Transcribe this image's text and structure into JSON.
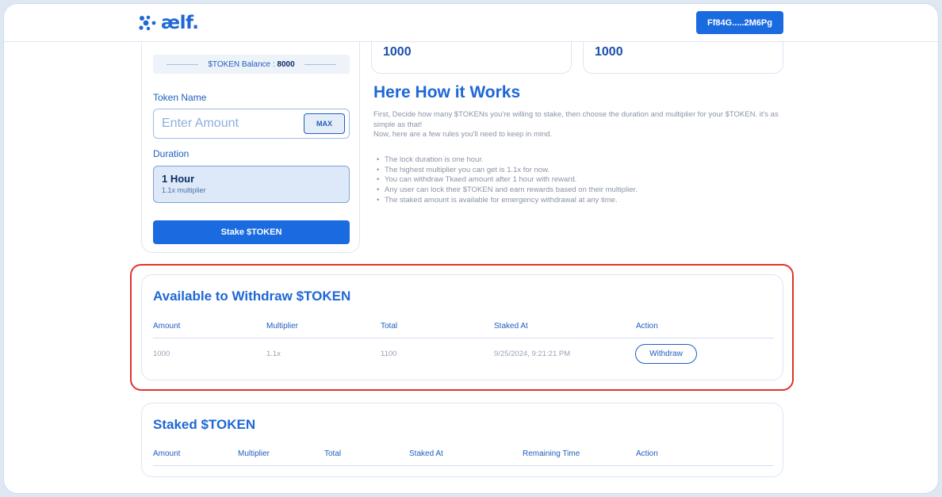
{
  "header": {
    "logo_text": "ælf.",
    "wallet_label": "Ff84G.....2M6Pg"
  },
  "stake_form": {
    "balance_label": "$TOKEN Balance : ",
    "balance_value": "8000",
    "token_name_label": "Token Name",
    "amount_placeholder": "Enter Amount",
    "max_label": "MAX",
    "duration_label": "Duration",
    "duration_option": {
      "title": "1 Hour",
      "subtitle": "1.1x multiplier"
    },
    "stake_button_label": "Stake $TOKEN"
  },
  "stats": [
    "1000",
    "1000"
  ],
  "how_it_works": {
    "title": "Here How it Works",
    "intro": "First, Decide how many $TOKENs you're willing to stake, then choose the duration and multiplier for your $TOKEN. it's as simple as that!",
    "intro2": "Now, here are a few rules you'll need to keep in mind.",
    "rules": [
      "The lock duration is one hour.",
      "The highest multiplier you can get is 1.1x for now.",
      "You can withdraw Tkaed amount after 1 hour with reward.",
      "Any user can lock their $TOKEN and earn rewards based on their multiplier.",
      "The staked amount is available for emergency withdrawal at any time."
    ]
  },
  "withdraw_table": {
    "title": "Available to Withdraw $TOKEN",
    "columns": [
      "Amount",
      "Multiplier",
      "Total",
      "Staked At",
      "Action"
    ],
    "rows": [
      {
        "amount": "1000",
        "multiplier": "1.1x",
        "total": "1100",
        "staked_at": "9/25/2024, 9:21:21 PM",
        "action": "Withdraw"
      }
    ]
  },
  "staked_table": {
    "title": "Staked $TOKEN",
    "columns": [
      "Amount",
      "Multiplier",
      "Total",
      "Staked At",
      "Remaining Time",
      "Action"
    ]
  },
  "colors": {
    "brand": "#1e67d6",
    "button": "#1a6ae0",
    "highlight": "#e0332f"
  }
}
